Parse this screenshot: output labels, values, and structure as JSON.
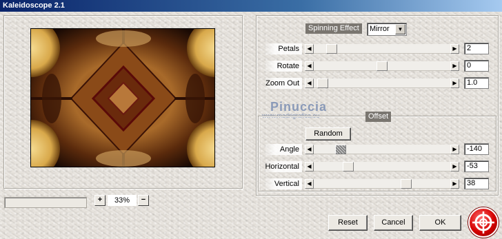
{
  "window": {
    "title": "Kaleidoscope 2.1"
  },
  "spinning": {
    "section_label": "Spinning Effect",
    "mode": {
      "selected": "Mirror"
    },
    "petals": {
      "label": "Petals",
      "value": "2",
      "fraction": 0.1
    },
    "rotate": {
      "label": "Rotate",
      "value": "0",
      "fraction": 0.5
    },
    "zoom_out": {
      "label": "Zoom Out",
      "value": "1.0",
      "fraction": 0.03
    }
  },
  "offset": {
    "section_label": "Offset",
    "random_label": "Random",
    "angle": {
      "label": "Angle",
      "value": "-140",
      "fraction": 0.17
    },
    "horizontal": {
      "label": "Horizontal",
      "value": "-53",
      "fraction": 0.23
    },
    "vertical": {
      "label": "Vertical",
      "value": "38",
      "fraction": 0.69
    }
  },
  "watermark": {
    "name": "Pinuccia",
    "url": "www.madrigrafica.eu"
  },
  "zoom": {
    "plus": "+",
    "minus": "−",
    "value": "33%"
  },
  "footer": {
    "reset_label": "Reset",
    "cancel_label": "Cancel",
    "ok_label": "OK"
  },
  "icons": {
    "zoom_in": "plus-icon",
    "zoom_out": "minus-icon",
    "logo": "lifebuoy-logo-icon",
    "dropdown": "chevron-down-icon"
  },
  "colors": {
    "title_bar": "#0a246a",
    "section_label": "#7a7670",
    "logo": "#d40000"
  }
}
